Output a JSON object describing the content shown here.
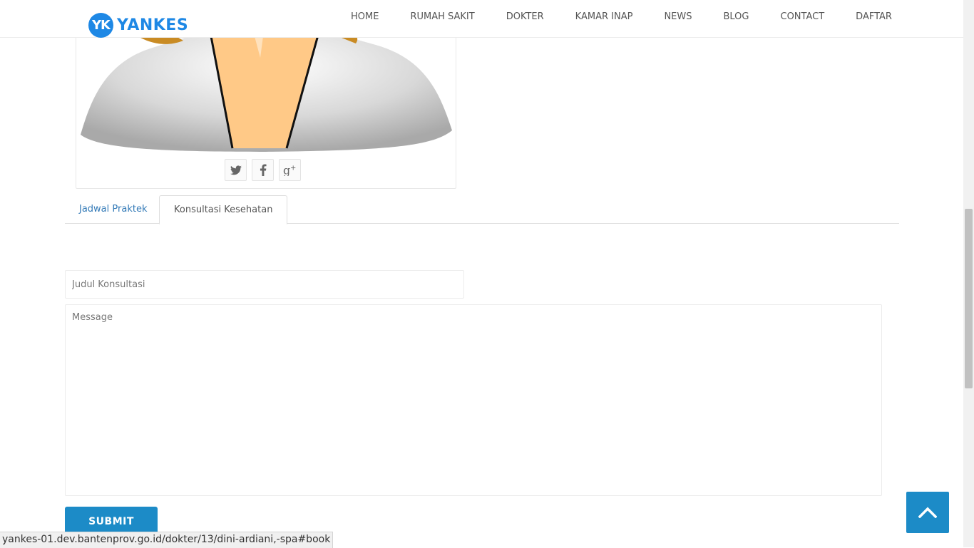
{
  "brand": {
    "badge": "YK",
    "name": "YANKES",
    "color": "#1e88e5"
  },
  "nav": [
    {
      "label": "HOME"
    },
    {
      "label": "RUMAH SAKIT"
    },
    {
      "label": "DOKTER"
    },
    {
      "label": "KAMAR INAP"
    },
    {
      "label": "NEWS"
    },
    {
      "label": "BLOG"
    },
    {
      "label": "CONTACT"
    },
    {
      "label": "DAFTAR"
    }
  ],
  "profile": {
    "avatar_icon": "doctor-placeholder-avatar",
    "socials": [
      {
        "icon": "twitter-icon"
      },
      {
        "icon": "facebook-icon"
      },
      {
        "icon": "google-plus-icon"
      }
    ]
  },
  "tabs": [
    {
      "label": "Jadwal Praktek",
      "active": false
    },
    {
      "label": "Konsultasi Kesehatan",
      "active": true
    }
  ],
  "form": {
    "title_placeholder": "Judul Konsultasi",
    "message_placeholder": "Message",
    "submit_label": "SUBMIT"
  },
  "back_to_top_icon": "chevron-up-icon",
  "status_bar": {
    "url": "yankes-01.dev.bantenprov.go.id/dokter/13/dini-ardiani,-spa#book"
  },
  "colors": {
    "accent": "#1c8bc7",
    "link": "#337ab7"
  }
}
